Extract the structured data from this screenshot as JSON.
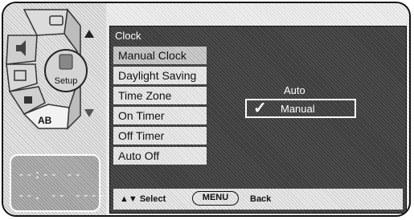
{
  "panel": {
    "title": "Clock",
    "menu_items": [
      {
        "label": "Manual Clock"
      },
      {
        "label": "Daylight Saving"
      },
      {
        "label": "Time Zone"
      },
      {
        "label": "On Timer"
      },
      {
        "label": "Off Timer"
      },
      {
        "label": "Auto Off"
      }
    ],
    "options": {
      "auto": "Auto",
      "manual": "Manual",
      "selected_mark": "✓"
    },
    "footer": {
      "select_text": "▲▼ Select",
      "menu_button": "MENU",
      "back_text": "Back"
    }
  },
  "wheel": {
    "center_label": "Setup",
    "segments": [
      {
        "label": "",
        "icon": "tv-icon"
      },
      {
        "label": "",
        "icon": "speaker-icon"
      },
      {
        "label": "",
        "icon": "picture-icon"
      },
      {
        "label": "",
        "icon": "lock-icon"
      },
      {
        "label": "AB",
        "icon": "language-icon"
      }
    ]
  },
  "display": {
    "time_line": "--:-- --",
    "date_line": "--. -- ----"
  }
}
